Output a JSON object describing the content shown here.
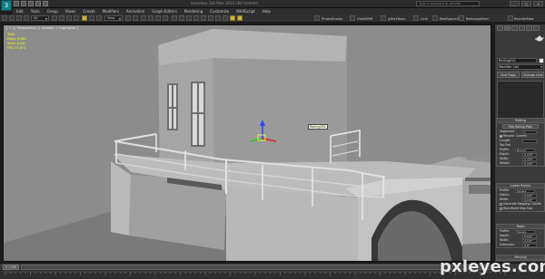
{
  "app": {
    "title_text": "Autodesk 3ds Max 2010   x64      Untitled",
    "logo_glyph": "3",
    "search_placeholder": "Type a keyword or phrase",
    "window_buttons": [
      "_",
      "□",
      "×"
    ]
  },
  "menu": {
    "items": [
      "Edit",
      "Tools",
      "Group",
      "Views",
      "Create",
      "Modifiers",
      "Animation",
      "Graph Editors",
      "Rendering",
      "Customize",
      "MAXScript",
      "Help"
    ]
  },
  "toolbar": {
    "selection_filter": "All",
    "ref_coord": "View",
    "named_sets": [
      "PhotoStudio",
      "ViewSMR",
      "gTextTown",
      "Link",
      "BeeSpace3",
      "BehangaFeer",
      "RenderMed"
    ]
  },
  "viewport": {
    "label": "[ + ] [ Perspective ] [ Smooth + Highlights ]",
    "stats": [
      {
        "label": "Total",
        "value": ""
      },
      {
        "label": "Polys:",
        "value": "8,080"
      },
      {
        "label": "Verts:",
        "value": "8,040"
      },
      {
        "label": "FPS:",
        "value": "97,674"
      }
    ],
    "tooltip": "Railing001"
  },
  "command_panel": {
    "object_name": "Railing001",
    "modifier_list": "Modifier List",
    "buttons": [
      "Unit Flags",
      "Change Unit"
    ],
    "rollout_railing": {
      "title": "Railing",
      "pick_button": "Pick Railing Path",
      "segments_label": "Segments:",
      "segments_value": "1",
      "respect_corners": "Respect Corners",
      "length_label": "Length:",
      "length_value": "",
      "top_rail": "Top Rail",
      "profile_label": "Profile:",
      "profile_value": "Round",
      "depth_label": "Depth:",
      "depth_value": "0,375\"",
      "width_label": "Width:",
      "width_value": "0,375\"",
      "height_label": "Height:",
      "height_value": "0,375\""
    },
    "rollout_lower": {
      "title": "Lower Rail(s)",
      "profile_label": "Profile:",
      "profile_value": "Square",
      "depth_label": "Depth:",
      "depth_value": "0,167\"",
      "width_label": "Width:",
      "width_value": "0,167\"",
      "mapping_label": "Generate Mapping Coords",
      "realworld_label": "Real-World Map Size"
    },
    "rollout_posts": {
      "title": "Posts",
      "profile_label": "Profile:",
      "profile_value": "Square",
      "depth_label": "Depth:",
      "depth_value": "0,167\"",
      "width_label": "Width:",
      "width_value": "0,167\"",
      "extension_label": "Extension:",
      "extension_value": "0,0\""
    },
    "fencing_title": "Fencing"
  },
  "timeline": {
    "slider": "0 / 100"
  },
  "watermark": "pxleyes.com"
}
